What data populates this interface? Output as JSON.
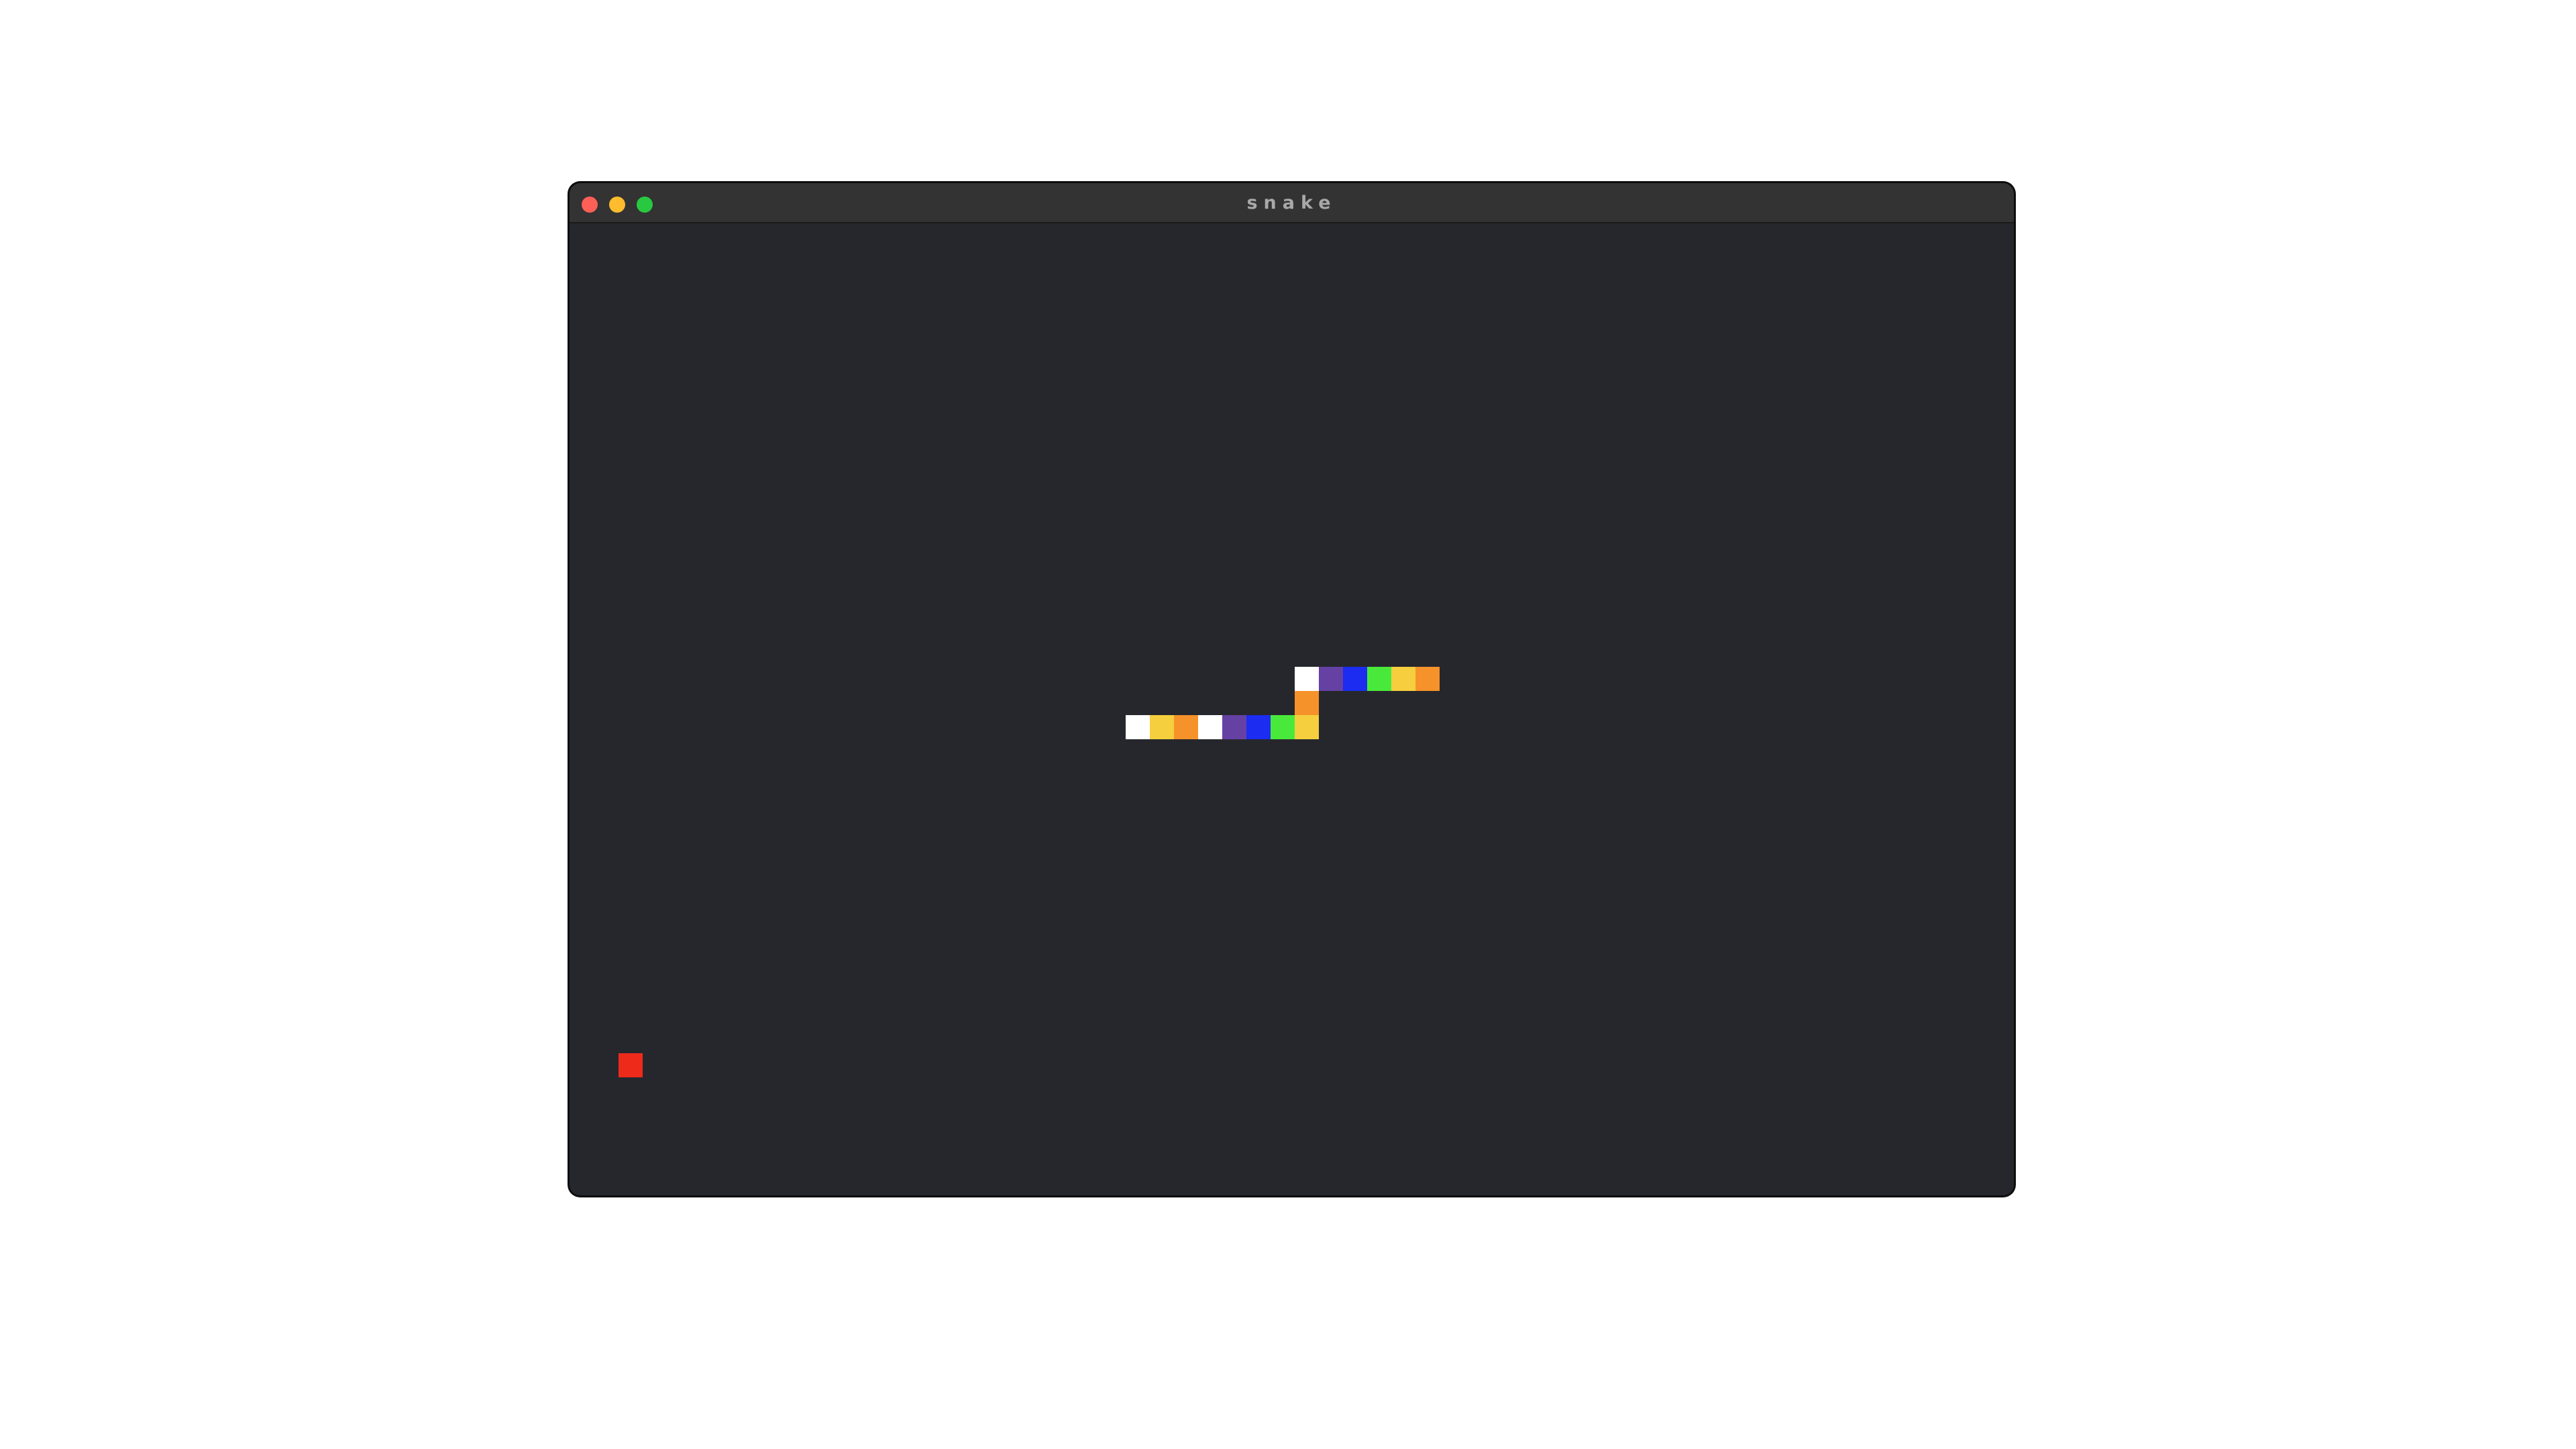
{
  "window": {
    "title": "snake"
  },
  "board": {
    "background": "#26272c"
  },
  "food": {
    "color": "#ee2a1b",
    "col": 2,
    "row": 34
  },
  "snake": {
    "segments": [
      {
        "col": 23,
        "row": 20,
        "color": "#ffffff"
      },
      {
        "col": 24,
        "row": 20,
        "color": "#f5cf3e"
      },
      {
        "col": 25,
        "row": 20,
        "color": "#f6922a"
      },
      {
        "col": 26,
        "row": 20,
        "color": "#ffffff"
      },
      {
        "col": 27,
        "row": 20,
        "color": "#6541a3"
      },
      {
        "col": 28,
        "row": 20,
        "color": "#1c2cf0"
      },
      {
        "col": 29,
        "row": 20,
        "color": "#49e93c"
      },
      {
        "col": 30,
        "row": 20,
        "color": "#f5cf3e"
      },
      {
        "col": 30,
        "row": 19,
        "color": "#f6922a"
      },
      {
        "col": 30,
        "row": 18,
        "color": "#ffffff"
      },
      {
        "col": 31,
        "row": 18,
        "color": "#6541a3"
      },
      {
        "col": 32,
        "row": 18,
        "color": "#1c2cf0"
      },
      {
        "col": 33,
        "row": 18,
        "color": "#49e93c"
      },
      {
        "col": 34,
        "row": 18,
        "color": "#f5cf3e"
      },
      {
        "col": 35,
        "row": 18,
        "color": "#f6922a"
      }
    ]
  }
}
